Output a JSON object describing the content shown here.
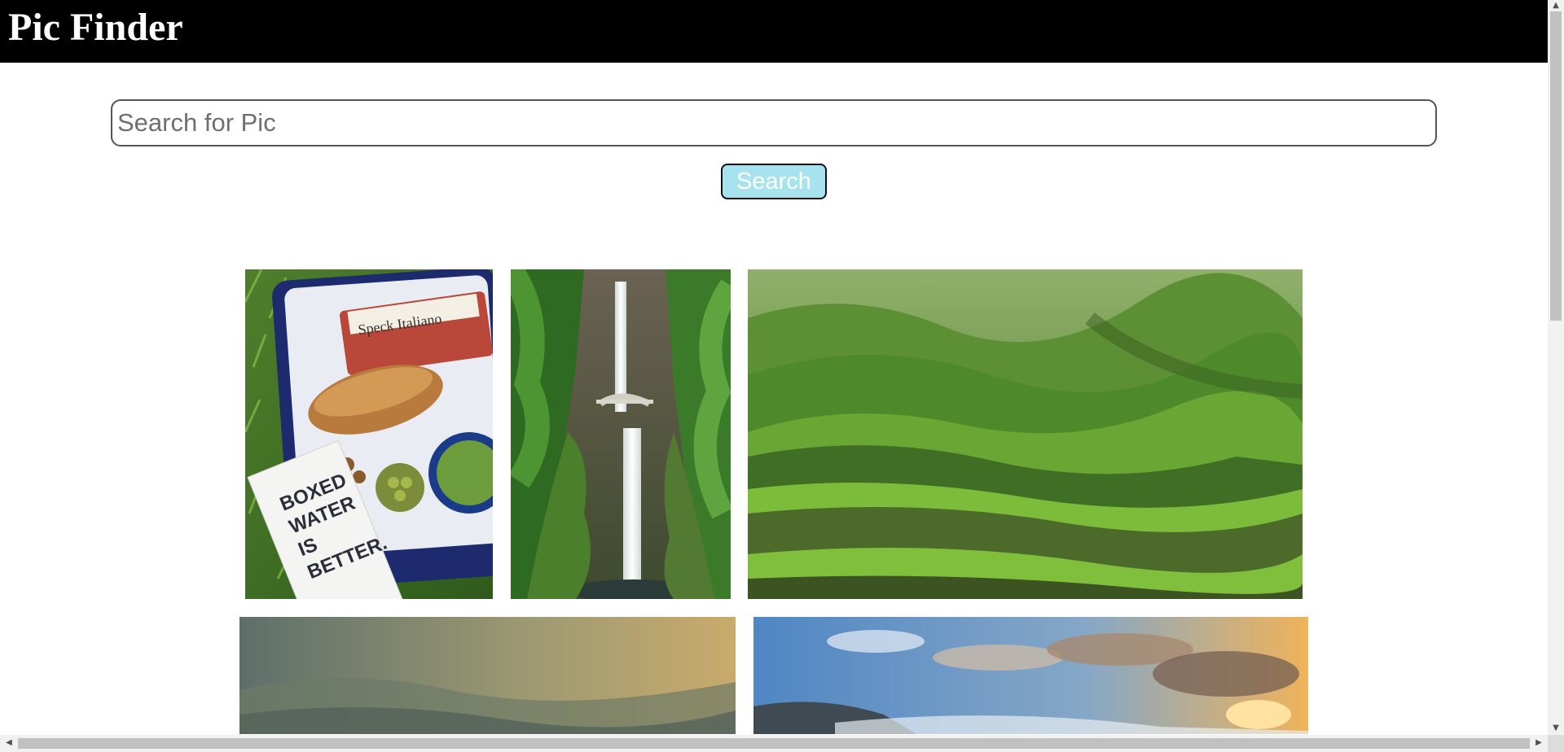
{
  "header": {
    "title": "Pic Finder",
    "background": "#000000"
  },
  "search": {
    "placeholder": "Search for Pic",
    "value": "",
    "button_label": "Search",
    "button_color": "#a6e3ee"
  },
  "gallery": {
    "photos": [
      {
        "name": "picnic-cooler-photo",
        "subject": "picnic cooler with bread, salami, olives and boxed water",
        "text": [
          "Speck Italiano",
          "BOXED WATER IS BETTER."
        ]
      },
      {
        "name": "waterfall-photo",
        "subject": "tall waterfall with footbridge in green gorge"
      },
      {
        "name": "green-hills-photo",
        "subject": "rolling green mountain hills"
      },
      {
        "name": "hazy-mountains-photo",
        "subject": "hazy golden mountain valley"
      },
      {
        "name": "sunset-sky-photo",
        "subject": "cloudy sky at sunset over hills"
      }
    ]
  },
  "scrollbars": {
    "vertical_arrows": [
      "▲",
      "▼"
    ],
    "horizontal_arrows": [
      "◀",
      "▶"
    ]
  }
}
